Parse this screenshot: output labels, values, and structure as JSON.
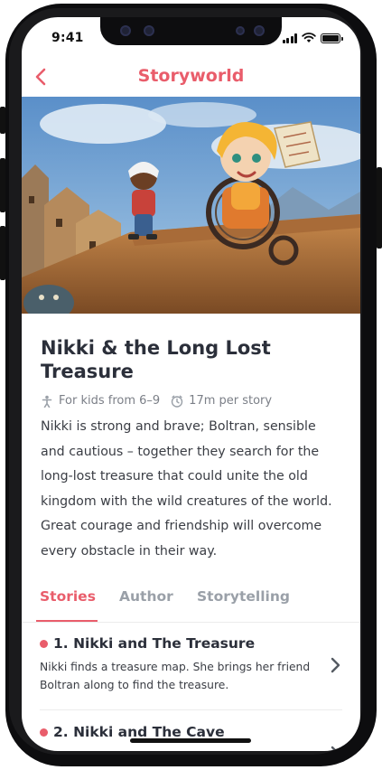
{
  "status_bar": {
    "time": "9:41"
  },
  "nav": {
    "title": "Storyworld",
    "back_icon": "chevron-left-icon"
  },
  "colors": {
    "accent": "#e95d6b",
    "text": "#2b2f3a",
    "muted": "#7b7f87"
  },
  "story": {
    "title": "Nikki & the Long Lost Treasure",
    "age": "For kids from 6–9",
    "duration": "17m per story",
    "description": "Nikki is strong and brave; Boltran, sensible and cautious – together they search for the long-lost treasure that could unite the old kingdom with the wild creatures of the world. Great courage and friendship will overcome every obstacle in their way."
  },
  "tabs": [
    {
      "label": "Stories",
      "active": true
    },
    {
      "label": "Author",
      "active": false
    },
    {
      "label": "Storytelling",
      "active": false
    }
  ],
  "episodes": [
    {
      "title": "1. Nikki and The Treasure",
      "summary": "Nikki finds a treasure map. She brings her friend Boltran along to find the treasure."
    },
    {
      "title": "2. Nikki and The Cave",
      "summary": ""
    }
  ]
}
